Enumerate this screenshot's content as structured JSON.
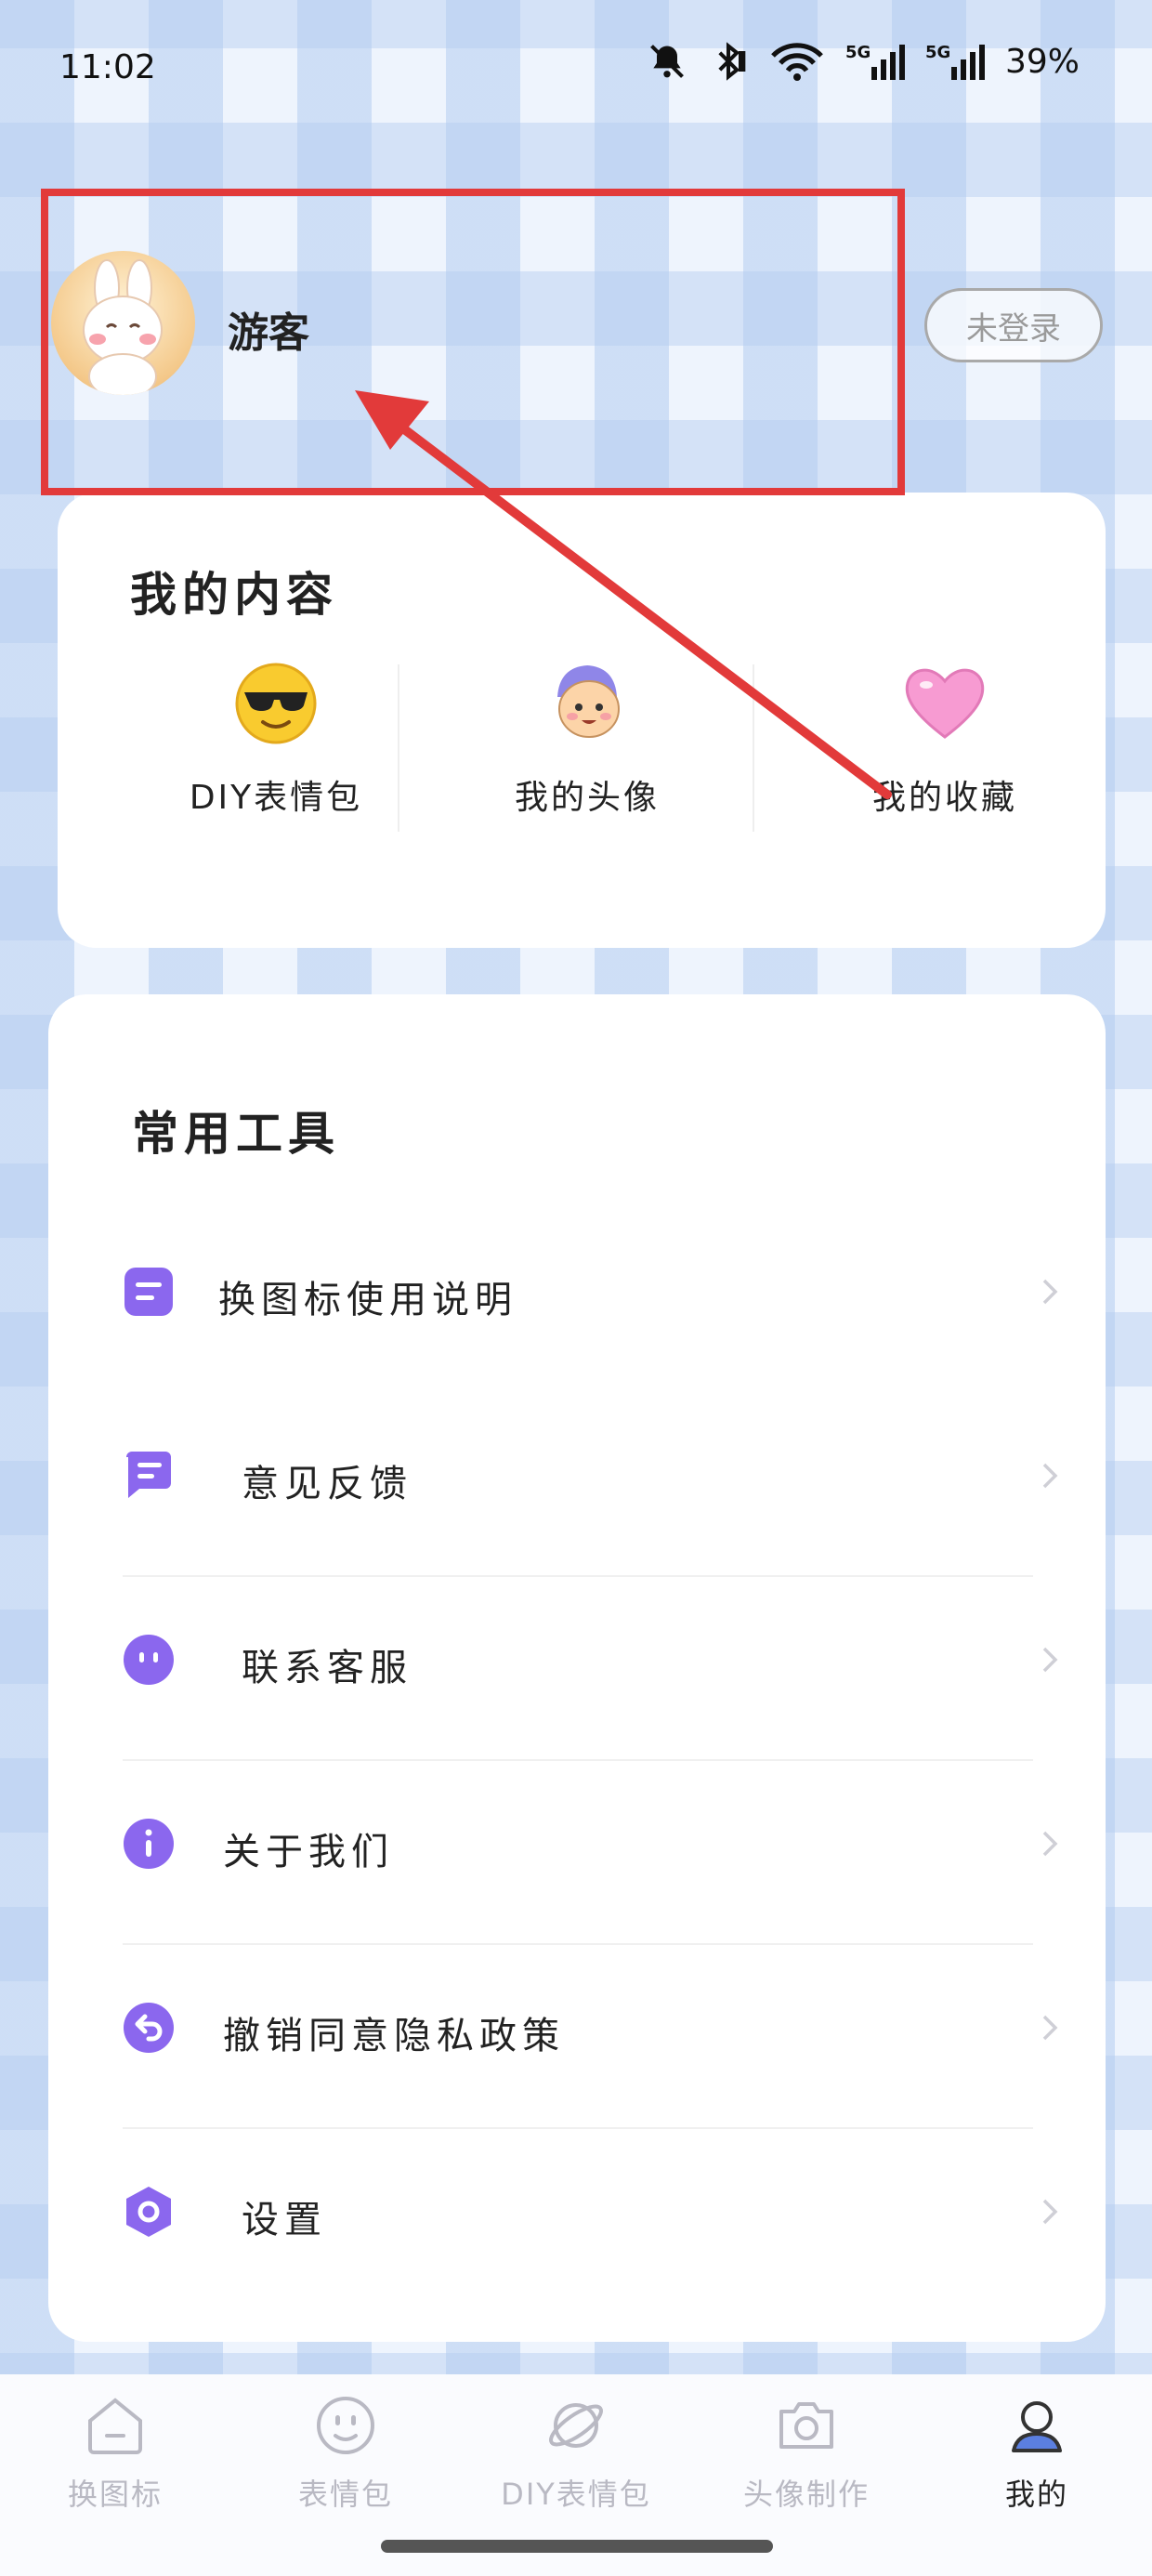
{
  "status_bar": {
    "time": "11:02",
    "battery": "39%",
    "icons": [
      "mute-bell-icon",
      "bluetooth-icon",
      "wifi-icon",
      "5g-signal-icon",
      "5g-signal-icon"
    ]
  },
  "profile": {
    "username": "游客",
    "login_button": "未登录"
  },
  "my_content": {
    "title": "我的内容",
    "items": [
      {
        "label": "DIY表情包",
        "icon": "sunglasses-emoji-icon"
      },
      {
        "label": "我的头像",
        "icon": "avatar-face-icon"
      },
      {
        "label": "我的收藏",
        "icon": "heart-icon"
      }
    ]
  },
  "tools": {
    "title": "常用工具",
    "items": [
      {
        "label": "换图标使用说明",
        "icon": "document-icon"
      },
      {
        "label": "意见反馈",
        "icon": "chat-icon"
      },
      {
        "label": "联系客服",
        "icon": "service-face-icon"
      },
      {
        "label": "关于我们",
        "icon": "info-icon"
      },
      {
        "label": "撤销同意隐私政策",
        "icon": "undo-icon"
      },
      {
        "label": "设置",
        "icon": "hexagon-settings-icon"
      }
    ]
  },
  "bottom_nav": {
    "items": [
      {
        "label": "换图标",
        "icon": "change-icon-icon",
        "active": false
      },
      {
        "label": "表情包",
        "icon": "smiley-icon",
        "active": false
      },
      {
        "label": "DIY表情包",
        "icon": "planet-icon",
        "active": false
      },
      {
        "label": "头像制作",
        "icon": "camera-icon",
        "active": false
      },
      {
        "label": "我的",
        "icon": "user-icon",
        "active": true
      }
    ]
  },
  "colors": {
    "accent_purple": "#8b67ee",
    "annotation_red": "#e23a3a"
  }
}
